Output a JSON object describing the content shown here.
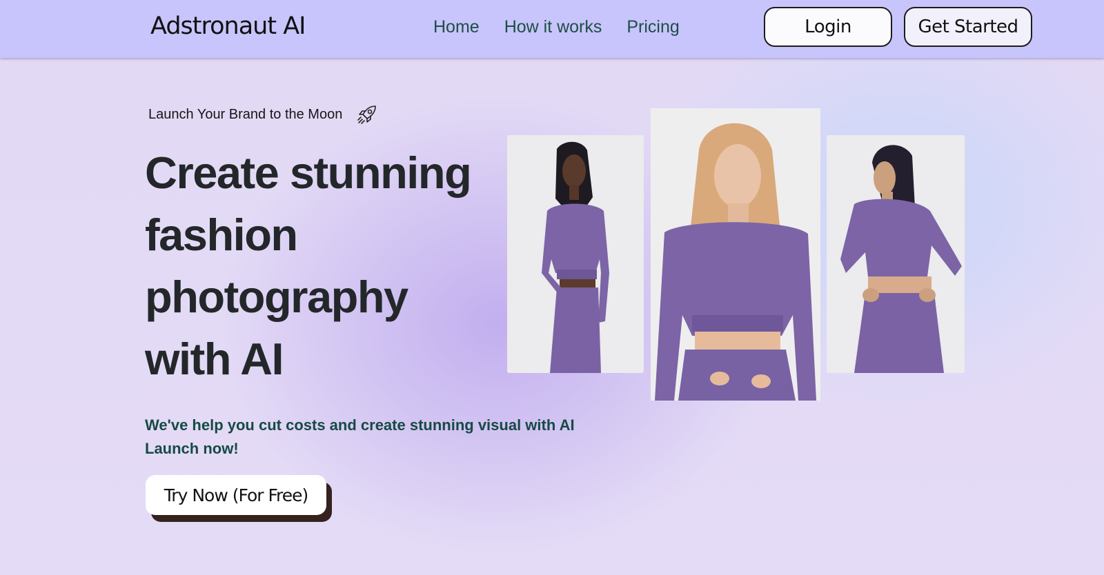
{
  "header": {
    "logo": "Adstronaut AI",
    "nav": [
      {
        "label": "Home"
      },
      {
        "label": "How it works"
      },
      {
        "label": "Pricing"
      }
    ],
    "login_label": "Login",
    "get_started_label": "Get Started"
  },
  "hero": {
    "tagline": "Launch Your Brand to the Moon",
    "tagline_icon": "rocket-icon",
    "headline": "Create stunning fashion photography with AI",
    "subtext_line1": "We've help you cut costs and create stunning visual with AI",
    "subtext_line2": "Launch now!",
    "cta_label": "Try Now (For Free)"
  },
  "colors": {
    "header_bg": "#c7c5fb",
    "outfit": "#7c64a6",
    "heading": "#23272a",
    "subtext": "#164a44"
  }
}
